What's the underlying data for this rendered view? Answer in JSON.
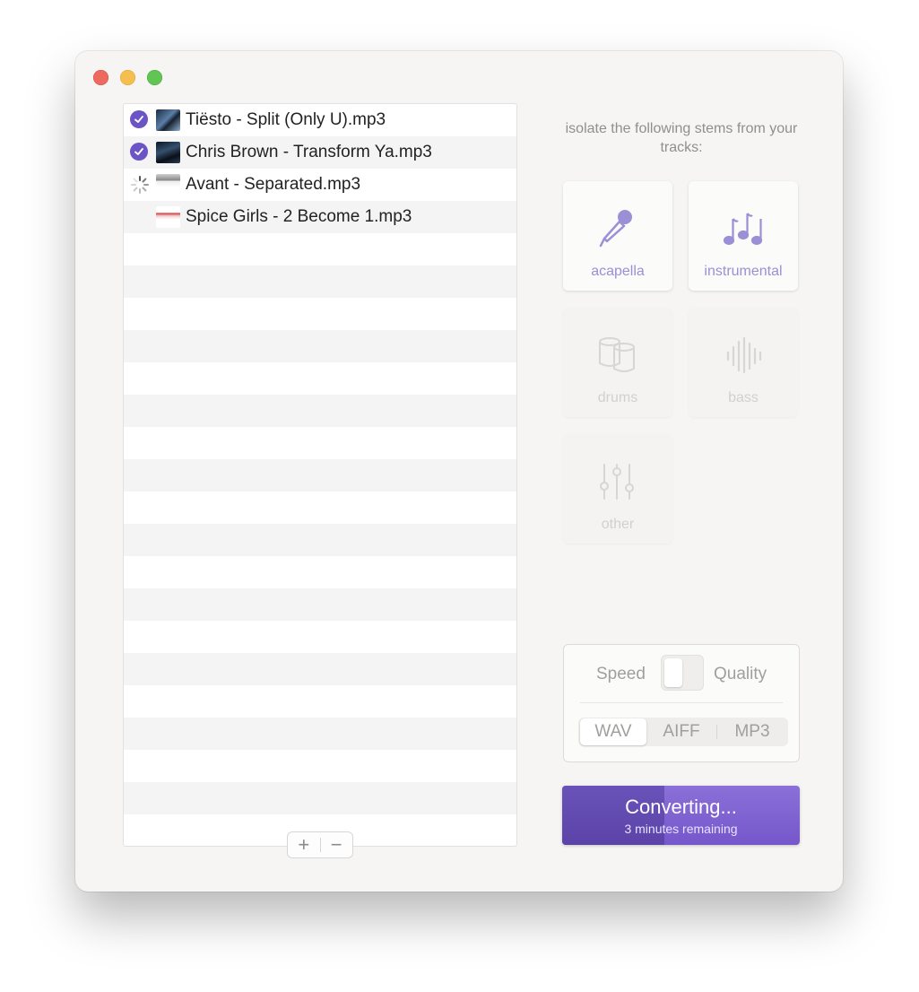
{
  "tracks": [
    {
      "name": "Tiësto - Split (Only U).mp3",
      "status": "done"
    },
    {
      "name": "Chris Brown - Transform Ya.mp3",
      "status": "done"
    },
    {
      "name": "Avant - Separated.mp3",
      "status": "processing"
    },
    {
      "name": "Spice Girls - 2 Become 1.mp3",
      "status": "queued"
    }
  ],
  "list_controls": {
    "add": "+",
    "remove": "−"
  },
  "stems": {
    "heading": "isolate the following stems from your tracks:",
    "acapella": "acapella",
    "instrumental": "instrumental",
    "drums": "drums",
    "bass": "bass",
    "other": "other"
  },
  "settings": {
    "speed_label": "Speed",
    "quality_label": "Quality",
    "formats": [
      "WAV",
      "AIFF",
      "MP3"
    ],
    "selected_format": "WAV"
  },
  "convert": {
    "title": "Converting...",
    "subtitle": "3 minutes remaining",
    "progress": 0.43
  },
  "colors": {
    "accent": "#6a54c6",
    "stem_active": "#9b8fd6"
  }
}
